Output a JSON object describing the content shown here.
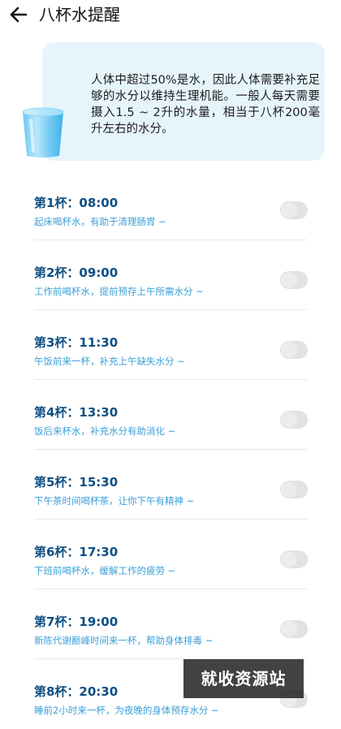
{
  "header": {
    "title": "八杯水提醒",
    "back_icon": "arrow-left-icon"
  },
  "intro": {
    "text": "人体中超过50%是水，因此人体需要补充足够的水分以维持生理机能。一般人每天需要摄入1.5 ~ 2升的水量，相当于八杯200毫升左右的水分。",
    "icon": "water-glass-icon",
    "background_color": "#e6f5fc"
  },
  "cups": [
    {
      "title": "第1杯：08:00",
      "subtitle": "起床喝杯水，有助于清理肠胃 ~",
      "enabled": false
    },
    {
      "title": "第2杯：09:00",
      "subtitle": "工作前喝杯水，提前预存上午所需水分 ~",
      "enabled": false
    },
    {
      "title": "第3杯：11:30",
      "subtitle": "午饭前来一杯，补充上午缺失水分 ~",
      "enabled": false
    },
    {
      "title": "第4杯：13:30",
      "subtitle": "饭后来杯水，补充水分有助消化 ~",
      "enabled": false
    },
    {
      "title": "第5杯：15:30",
      "subtitle": "下午茶时间喝杯茶，让你下午有精神 ~",
      "enabled": false
    },
    {
      "title": "第6杯：17:30",
      "subtitle": "下班前喝杯水，缓解工作的疲劳 ~",
      "enabled": false
    },
    {
      "title": "第7杯：19:00",
      "subtitle": "新陈代谢巅峰时间来一杯，帮助身体排毒 ~",
      "enabled": false
    },
    {
      "title": "第8杯：20:30",
      "subtitle": "睡前2小时来一杯，为夜晚的身体预存水分 ~",
      "enabled": false
    }
  ],
  "colors": {
    "title": "#0d4f84",
    "subtitle": "#3a9fd8",
    "toggle_off": "#e2e2e2"
  },
  "watermark": {
    "text": "就收资源站"
  }
}
